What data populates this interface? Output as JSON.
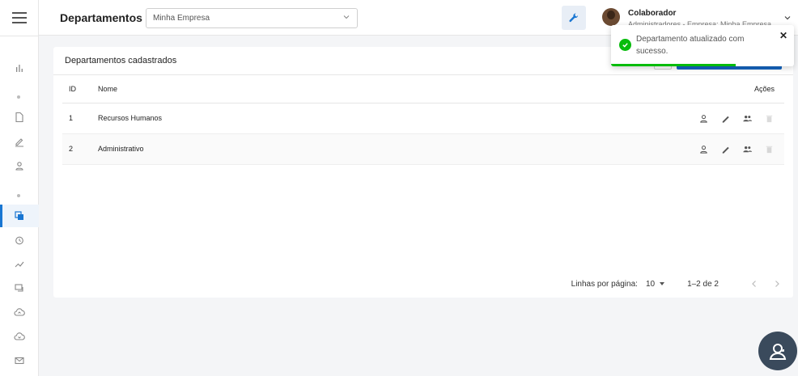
{
  "header": {
    "title": "Departamentos",
    "company_select": "Minha Empresa",
    "user": {
      "name": "Colaborador",
      "role": "Administradores - Empresa: Minha Empresa"
    }
  },
  "sidebar": {
    "items": [
      {
        "icon": "bar-chart-icon"
      },
      {
        "icon": "document-icon"
      },
      {
        "icon": "pen-icon"
      },
      {
        "icon": "user-icon"
      },
      {
        "icon": "copy-icon",
        "active": true
      },
      {
        "icon": "alarm-icon"
      },
      {
        "icon": "trend-icon"
      },
      {
        "icon": "chat-icon"
      },
      {
        "icon": "cloud-upload-icon"
      },
      {
        "icon": "cloud-download-icon"
      },
      {
        "icon": "mail-icon"
      }
    ]
  },
  "card": {
    "title": "Departamentos cadastrados",
    "columns": {
      "id": "ID",
      "name": "Nome",
      "actions": "Ações"
    },
    "rows": [
      {
        "id": "1",
        "name": "Recursos Humanos"
      },
      {
        "id": "2",
        "name": "Administrativo"
      }
    ],
    "pagination": {
      "rows_label": "Linhas por página:",
      "rows_per_page": "10",
      "range": "1–2 de 2"
    }
  },
  "toast": {
    "message": "Departamento atualizado com sucesso.",
    "close": "✕",
    "progress": 0.68
  },
  "colors": {
    "accent": "#1976d2",
    "success": "#07bc0c",
    "fab": "#3a4a5c"
  }
}
